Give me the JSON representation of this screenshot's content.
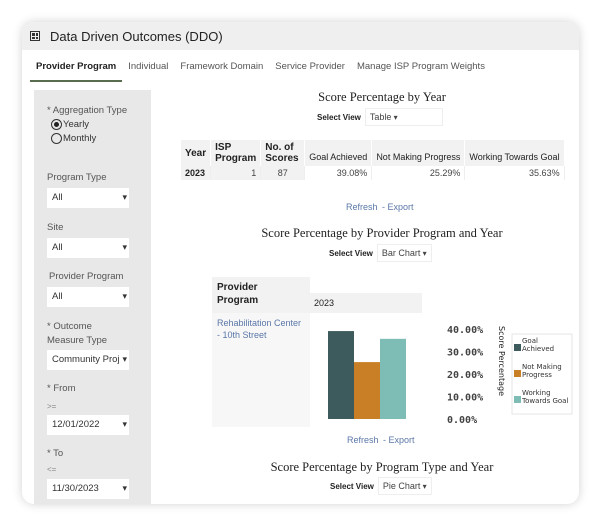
{
  "app": {
    "title": "Data Driven Outcomes (DDO)",
    "icon": "grid-icon"
  },
  "tabs": [
    {
      "label": "Provider Program",
      "active": true
    },
    {
      "label": "Individual"
    },
    {
      "label": "Framework Domain"
    },
    {
      "label": "Service Provider"
    },
    {
      "label": "Manage ISP Program Weights"
    }
  ],
  "filters": {
    "aggregation_label": "* Aggregation Type",
    "yearly": "Yearly",
    "monthly": "Monthly",
    "aggregation_selected": "Yearly",
    "program_type_label": "Program Type",
    "program_type": "All",
    "site_label": "Site",
    "site": "All",
    "provider_program_label": "Provider Program",
    "provider_program": "All",
    "outcome_label1": "* Outcome",
    "outcome_label2": "Measure Type",
    "outcome": "Community Proj",
    "from_label": "* From",
    "from_op": ">=",
    "from": "12/01/2022",
    "to_label": "* To",
    "to_op": "<=",
    "to": "11/30/2023"
  },
  "section1": {
    "title": "Score Percentage by Year",
    "select_label": "Select View",
    "view": "Table",
    "headers": [
      "Year",
      "ISP Program",
      "No. of Scores",
      "Goal Achieved",
      "Not Making Progress",
      "Working Towards Goal"
    ],
    "row": [
      "2023",
      "1",
      "87",
      "39.08%",
      "25.29%",
      "35.63%"
    ],
    "refresh": "Refresh",
    "export": "- Export"
  },
  "section2": {
    "title": "Score Percentage by Provider Program and Year",
    "select_label": "Select View",
    "view": "Bar Chart",
    "row_header": "Provider Program",
    "col_header": "2023",
    "program": "Rehabilitation Center - 10th Street",
    "refresh": "Refresh",
    "export": "- Export"
  },
  "section3": {
    "title": "Score Percentage by Program Type and Year",
    "select_label": "Select View",
    "view": "Pie Chart"
  },
  "chart_data": {
    "type": "bar",
    "categories": [
      "2023"
    ],
    "ylabel": "Score Percentage",
    "ylim": [
      0,
      40
    ],
    "yticks": [
      "0.00%",
      "10.00%",
      "20.00%",
      "30.00%",
      "40.00%"
    ],
    "legend": "right",
    "series": [
      {
        "name": "Goal Achieved",
        "values": [
          39.08
        ],
        "color": "#3d5b5c"
      },
      {
        "name": "Not Making Progress",
        "values": [
          25.29
        ],
        "color": "#c97f26"
      },
      {
        "name": "Working Towards Goal",
        "values": [
          35.63
        ],
        "color": "#7dbdb5"
      }
    ]
  }
}
